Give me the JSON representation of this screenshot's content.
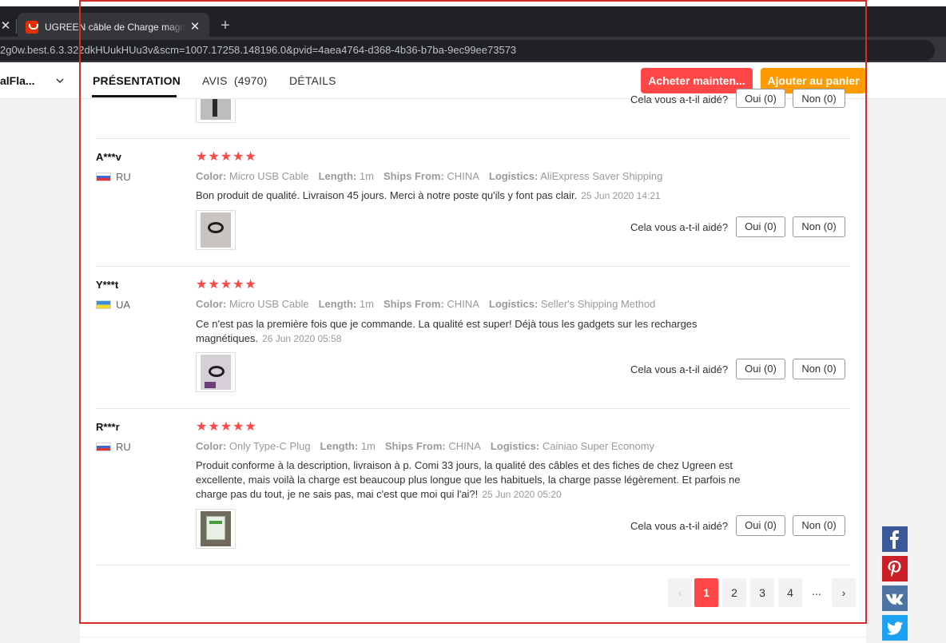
{
  "browser": {
    "prev_tab_close": "✕",
    "tab": {
      "title": "UGREEN câble de Charge magnétique",
      "close": "✕"
    },
    "new_tab": "+",
    "url": "2g0w.best.6.3.322dkHUukHUu3v&scm=1007.17258.148196.0&pvid=4aea4764-d368-4b36-b7ba-9ec99ee73573"
  },
  "nav": {
    "store_label": "alFla...",
    "tabs": [
      {
        "label": "PRÉSENTATION",
        "active": true
      },
      {
        "label": "AVIS  (4970)",
        "active": false
      },
      {
        "label": "DÉTAILS",
        "active": false
      }
    ],
    "buy_now": "Acheter mainten...",
    "add_to_cart": "Ajouter au panier"
  },
  "helpful_label": "Cela vous a-t-il aidé?",
  "yes_label": "Oui (0)",
  "no_label": "Non (0)",
  "attr_labels": {
    "color": "Color:",
    "length": "Length:",
    "ships_from": "Ships From:",
    "logistics": "Logistics:"
  },
  "reviews": [
    {
      "name": "A***v",
      "country": "RU",
      "rating": 5,
      "stars": "★★★★★",
      "color": "Micro USB Cable",
      "length": "1m",
      "ships_from": "CHINA",
      "logistics": "AliExpress Saver Shipping",
      "text": "Bon produit de qualité. Livraison 45 jours. Merci à notre poste qu'ils y font pas clair.",
      "date": "25 Jun 2020 14:21"
    },
    {
      "name": "Y***t",
      "country": "UA",
      "rating": 5,
      "stars": "★★★★★",
      "color": "Micro USB Cable",
      "length": "1m",
      "ships_from": "CHINA",
      "logistics": "Seller's Shipping Method",
      "text": "Ce n'est pas la première fois que je commande. La qualité est super! Déjà tous les gadgets sur les recharges magnétiques.",
      "date": "26 Jun 2020 05:58"
    },
    {
      "name": "R***r",
      "country": "RU",
      "rating": 5,
      "stars": "★★★★★",
      "color": "Only Type-C Plug",
      "length": "1m",
      "ships_from": "CHINA",
      "logistics": "Cainiao Super Economy",
      "text": "Produit conforme à la description, livraison à p. Comi 33 jours, la qualité des câbles et des fiches de chez Ugreen est excellente, mais voilà la charge est beaucoup plus longue que les habituels, la charge passe légèrement. Et parfois ne charge pas du tout, je ne sais pas, mai c'est que moi qui l'ai?!",
      "date": "25 Jun 2020 05:20"
    }
  ],
  "pagination": {
    "prev": "‹",
    "pages": [
      "1",
      "2",
      "3",
      "4"
    ],
    "current": "1",
    "ellipsis": "...",
    "next": "›"
  },
  "social": [
    "facebook-icon",
    "pinterest-icon",
    "vk-icon",
    "twitter-icon"
  ],
  "colors": {
    "accent_red": "#ff4747",
    "accent_orange": "#ff9a00",
    "highlight_border": "#d52b2b",
    "facebook": "#3b5998",
    "pinterest": "#cb2027",
    "vk": "#4c75a3",
    "twitter": "#1da1f2"
  }
}
